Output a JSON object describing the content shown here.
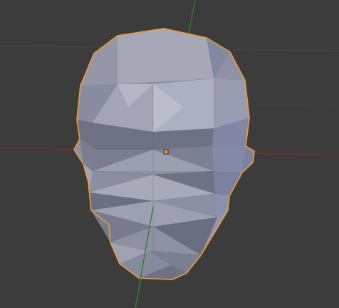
{
  "viewport": {
    "name": "3d-viewport",
    "background": "#3c3c3c",
    "grid_color": "#4a4a4a",
    "x_axis_color": "#7a2a2a",
    "y_axis_color": "#2f7a2f"
  },
  "object": {
    "name": "selected-low-poly-head",
    "selection_outline_color": "#e69a3b",
    "origin_color": "#e69a3b",
    "base_color": "#8e91a3",
    "light_color": "#b1b3c3",
    "dark_color": "#6b6e7e"
  }
}
